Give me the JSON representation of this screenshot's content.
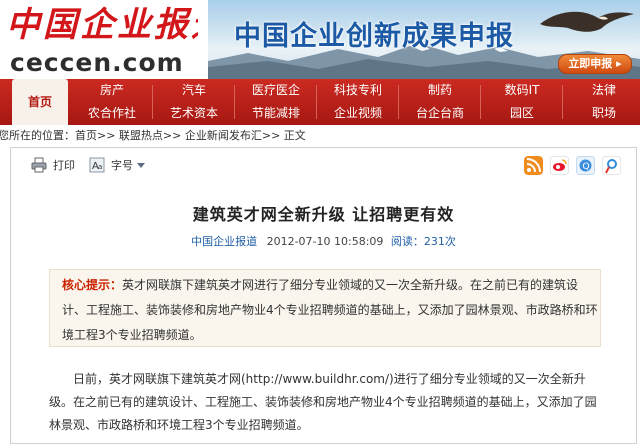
{
  "header": {
    "logo_cn": "中国企业报道",
    "logo_en": "ceccen.com",
    "banner_title": "中国企业创新成果申报",
    "banner_button": "立即申报 ▸"
  },
  "nav": {
    "home": "首页",
    "columns": [
      {
        "top": "房产",
        "bottom": "农合作社"
      },
      {
        "top": "汽车",
        "bottom": "艺术资本"
      },
      {
        "top": "医疗医企",
        "bottom": "节能减排"
      },
      {
        "top": "科技专利",
        "bottom": "企业视频"
      },
      {
        "top": "制药",
        "bottom": "台企台商"
      },
      {
        "top": "数码IT",
        "bottom": "园区"
      },
      {
        "top": "法律",
        "bottom": "职场"
      }
    ]
  },
  "breadcrumb": "您所在的位置：首页>> 联盟热点>> 企业新闻发布汇>> 正文",
  "toolbar": {
    "print": "打印",
    "fontsize": "字号"
  },
  "article": {
    "title": "建筑英才网全新升级  让招聘更有效",
    "source": "中国企业报道",
    "datetime": "2012-07-10 10:58:09",
    "views": "阅读：231次",
    "summary_label": "核心提示：",
    "summary_text": "英才网联旗下建筑英才网进行了细分专业领域的又一次全新升级。在之前已有的建筑设计、工程施工、装饰装修和房地产物业4个专业招聘频道的基础上，又添加了园林景观、市政路桥和环境工程3个专业招聘频道。",
    "body": "日前，英才网联旗下建筑英才网(http://www.buildhr.com/)进行了细分专业领域的又一次全新升级。在之前已有的建筑设计、工程施工、装饰装修和房地产物业4个专业招聘频道的基础上，又添加了园林景观、市政路桥和环境工程3个专业招聘频道。"
  },
  "colors": {
    "brand_red": "#c0201a",
    "link_blue": "#1f5fa6",
    "summary_label": "#cc2200"
  }
}
